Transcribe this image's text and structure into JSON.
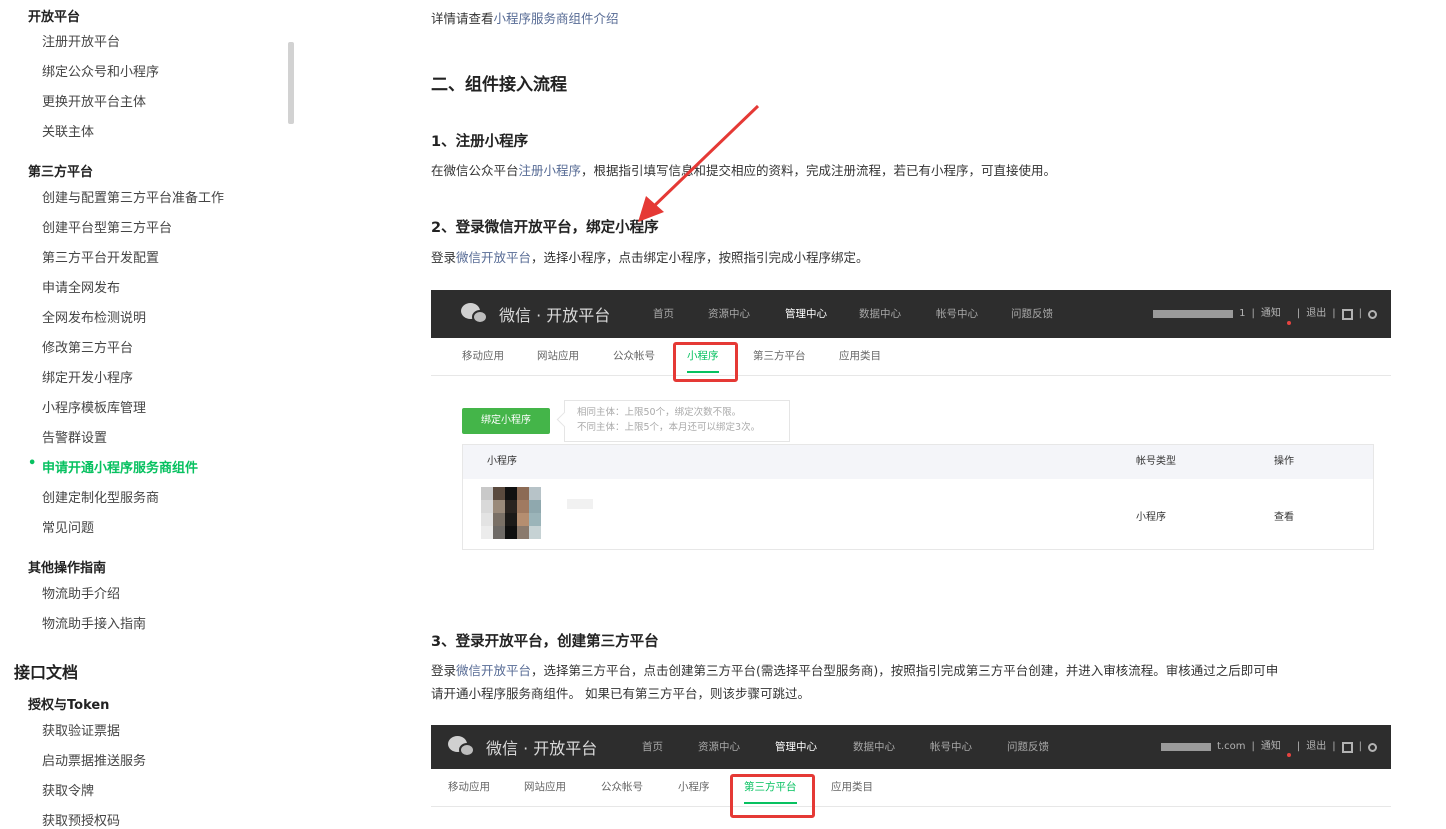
{
  "sidebar": {
    "groups": [
      {
        "title": "开放平台",
        "items": [
          "注册开放平台",
          "绑定公众号和小程序",
          "更换开放平台主体",
          "关联主体"
        ]
      },
      {
        "title": "第三方平台",
        "items": [
          "创建与配置第三方平台准备工作",
          "创建平台型第三方平台",
          "第三方平台开发配置",
          "申请全网发布",
          "全网发布检测说明",
          "修改第三方平台",
          "绑定开发小程序",
          "小程序模板库管理",
          "告警群设置",
          "申请开通小程序服务商组件",
          "创建定制化型服务商",
          "常见问题"
        ]
      },
      {
        "title": "其他操作指南",
        "items": [
          "物流助手介绍",
          "物流助手接入指南"
        ]
      }
    ],
    "section2": "接口文档",
    "group4": {
      "title": "授权与Token",
      "items": [
        "获取验证票据",
        "启动票据推送服务",
        "获取令牌",
        "获取预授权码"
      ]
    },
    "active_item": "申请开通小程序服务商组件"
  },
  "content": {
    "intro": {
      "prefix": "详情请查看",
      "link": "小程序服务商组件介绍"
    },
    "h2": "二、组件接入流程",
    "step1": {
      "title": "1、注册小程序",
      "text_prefix": "在微信公众平台",
      "link": "注册小程序",
      "text_suffix": "，根据指引填写信息和提交相应的资料，完成注册流程，若已有小程序，可直接使用。"
    },
    "step2": {
      "title": "2、登录微信开放平台，绑定小程序",
      "text_prefix": "登录",
      "link": "微信开放平台",
      "text_suffix": "，选择小程序，点击绑定小程序，按照指引完成小程序绑定。"
    },
    "step3": {
      "title": "3、登录开放平台，创建第三方平台",
      "text_prefix": "登录",
      "link": "微信开放平台",
      "line1_suffix": "，选择第三方平台，点击创建第三方平台(需选择平台型服务商)，按照指引完成第三方平台创建，并进入审核流程。审核通过之后即可申",
      "line2": "请开通小程序服务商组件。 如果已有第三方平台，则该步骤可跳过。"
    }
  },
  "shot1": {
    "logo_text": "微信 · 开放平台",
    "nav": [
      "首页",
      "资源中心",
      "管理中心",
      "数据中心",
      "帐号中心",
      "问题反馈"
    ],
    "active_nav": "管理中心",
    "right_notice": "通知",
    "right_logout": "退出",
    "right_suffix": "1",
    "subtabs": [
      "移动应用",
      "网站应用",
      "公众帐号",
      "小程序",
      "第三方平台",
      "应用类目"
    ],
    "active_subtab": "小程序",
    "bind_button": "绑定小程序",
    "tip_line1": "相同主体：上限50个，绑定次数不限。",
    "tip_line2": "不同主体：上限5个，本月还可以绑定3次。",
    "table_headers": [
      "小程序",
      "帐号类型",
      "操作"
    ],
    "row_type": "小程序",
    "row_action": "查看"
  },
  "shot2": {
    "logo_text": "微信 · 开放平台",
    "nav": [
      "首页",
      "资源中心",
      "管理中心",
      "数据中心",
      "帐号中心",
      "问题反馈"
    ],
    "active_nav": "管理中心",
    "right_domain": "t.com",
    "right_notice": "通知",
    "right_logout": "退出",
    "subtabs": [
      "移动应用",
      "网站应用",
      "公众帐号",
      "小程序",
      "第三方平台",
      "应用类目"
    ],
    "active_subtab": "第三方平台"
  },
  "colors": {
    "accent_green": "#07c160",
    "link": "#576b95",
    "highlight_red": "#e53935",
    "topbar": "#2d2d2d"
  }
}
